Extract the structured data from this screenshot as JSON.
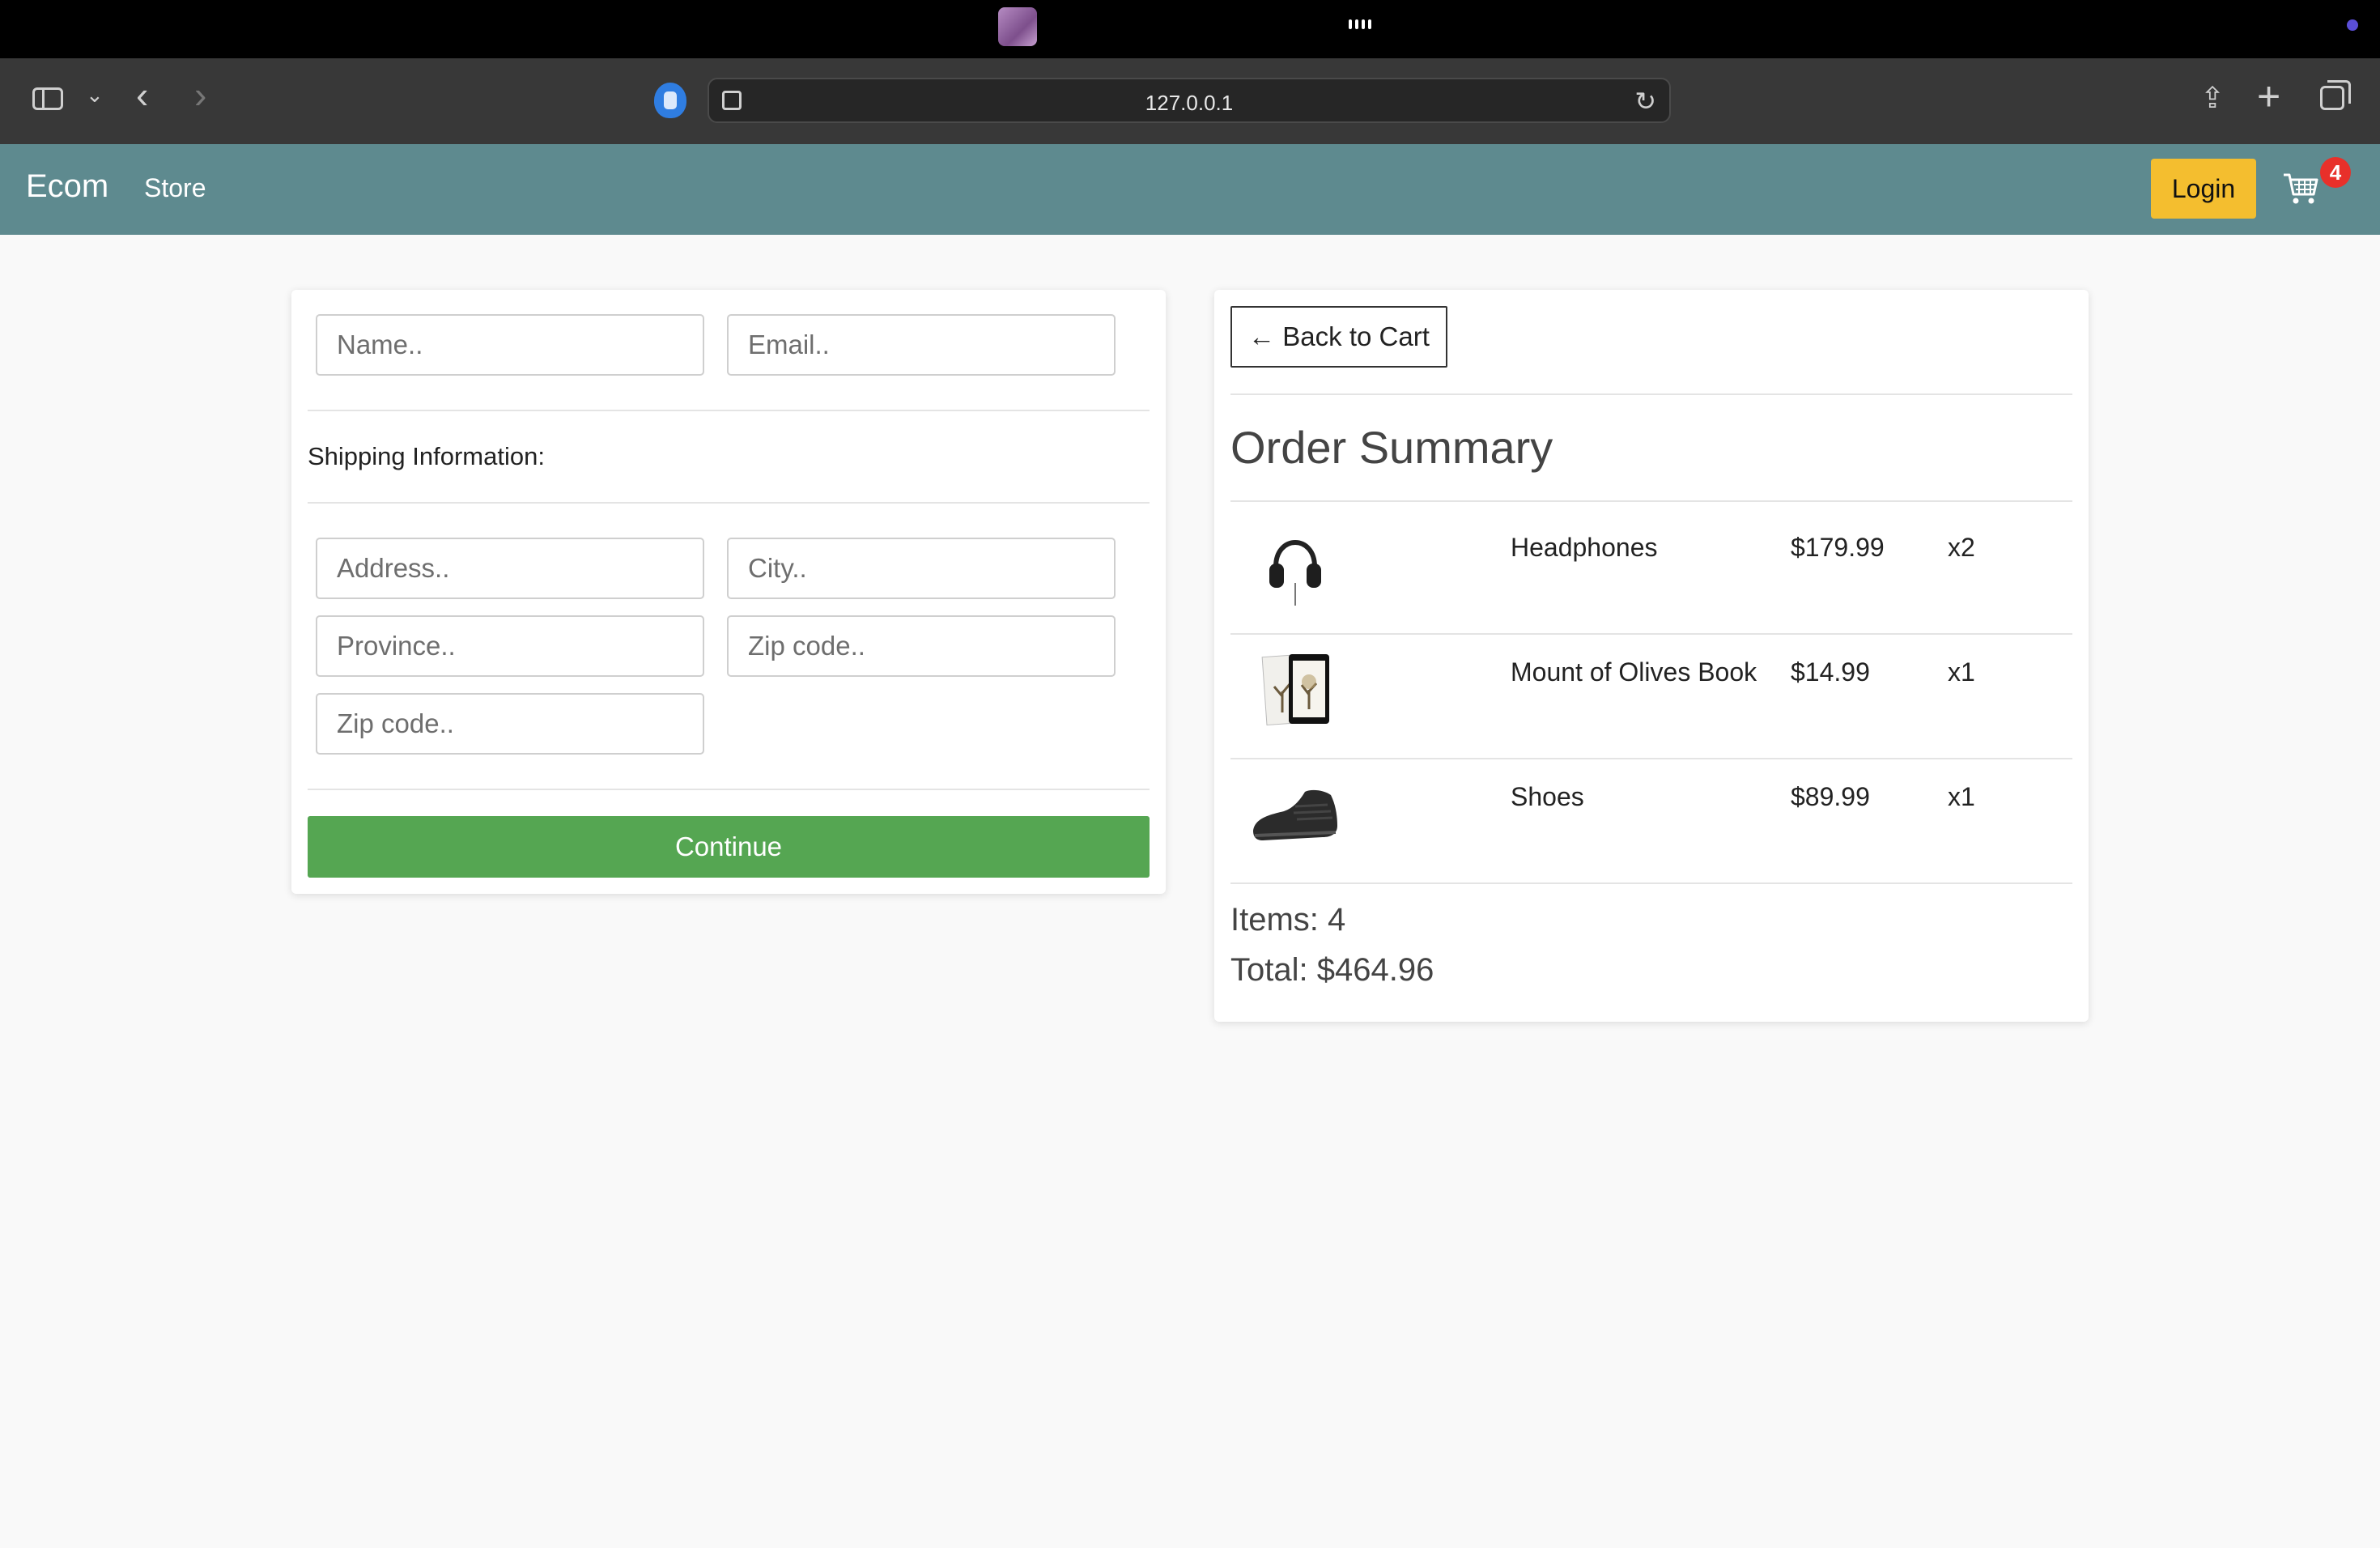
{
  "browser": {
    "url": "127.0.0.1"
  },
  "navbar": {
    "brand": "Ecom",
    "store_link": "Store",
    "login_label": "Login",
    "cart_count": "4"
  },
  "form": {
    "name_placeholder": "Name..",
    "email_placeholder": "Email..",
    "shipping_heading": "Shipping Information:",
    "address_placeholder": "Address..",
    "city_placeholder": "City..",
    "province_placeholder": "Province..",
    "zip1_placeholder": "Zip code..",
    "zip2_placeholder": "Zip code..",
    "continue_label": "Continue"
  },
  "summary": {
    "back_label": "← Back to Cart",
    "title": "Order Summary",
    "items": [
      {
        "name": "Headphones",
        "price": "$179.99",
        "qty": "x2",
        "image": "headphones-image"
      },
      {
        "name": "Mount of Olives Book",
        "price": "$14.99",
        "qty": "x1",
        "image": "book-image"
      },
      {
        "name": "Shoes",
        "price": "$89.99",
        "qty": "x1",
        "image": "shoes-image"
      }
    ],
    "items_count": "Items: 4",
    "total": "Total: $464.96"
  },
  "colors": {
    "navbar": "#5e8a8f",
    "login_button": "#f4be2f",
    "continue_button": "#55a652",
    "cart_badge": "#e8302a"
  }
}
